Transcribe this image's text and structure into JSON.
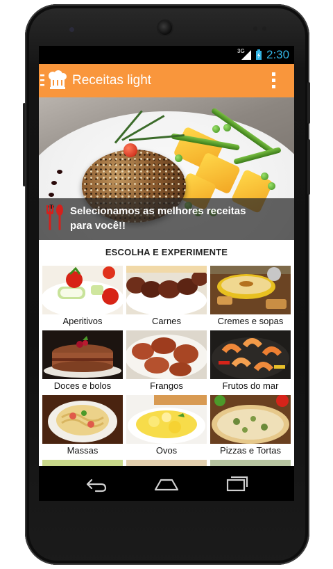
{
  "status_bar": {
    "network": "3G",
    "time": "2:30",
    "icons": [
      "signal-icon",
      "battery-icon"
    ]
  },
  "action_bar": {
    "title": "Receitas light",
    "app_icon": "chef-hat-icon",
    "menu_icon": "overflow-menu-icon"
  },
  "hero": {
    "banner_line1": "Selecionamos as melhores receitas",
    "banner_line2": "para você!!",
    "banner_icon": "fork-spoon-icon"
  },
  "section": {
    "title": "ESCOLHA E EXPERIMENTE",
    "categories": [
      {
        "label": "Aperitivos"
      },
      {
        "label": "Carnes"
      },
      {
        "label": "Cremes e sopas"
      },
      {
        "label": "Doces e bolos"
      },
      {
        "label": "Frangos"
      },
      {
        "label": "Frutos do mar"
      },
      {
        "label": "Massas"
      },
      {
        "label": "Ovos"
      },
      {
        "label": "Pizzas e Tortas"
      }
    ]
  },
  "nav_bar": {
    "back": "back-icon",
    "home": "home-icon",
    "recents": "recents-icon"
  },
  "colors": {
    "action_bar": "#f9963c",
    "clock": "#33b5e5"
  }
}
